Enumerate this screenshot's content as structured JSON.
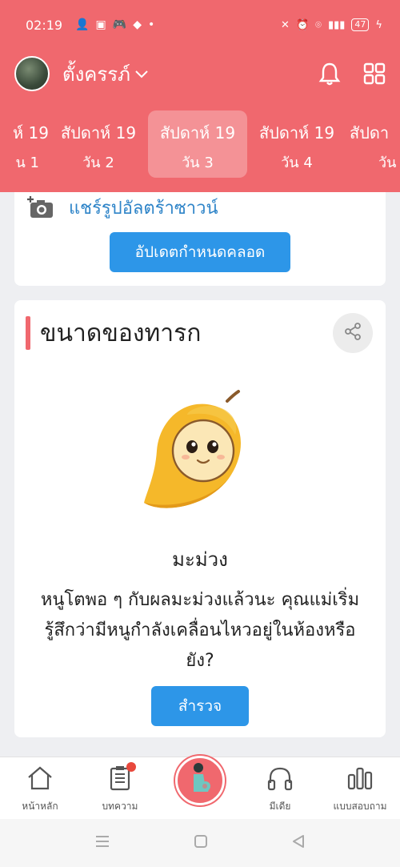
{
  "status_bar": {
    "time": "02:19",
    "battery": "47"
  },
  "header": {
    "username": "ตั้งครรภ์",
    "chevron": "⌄"
  },
  "weeks": [
    {
      "week": "ห์ 19",
      "day": "น 1"
    },
    {
      "week": "สัปดาห์ 19",
      "day": "วัน 2"
    },
    {
      "week": "สัปดาห์ 19",
      "day": "วัน 3",
      "active": true
    },
    {
      "week": "สัปดาห์ 19",
      "day": "วัน 4"
    },
    {
      "week": "สัปดา",
      "day": "วัน"
    }
  ],
  "card_top": {
    "share_photo_label": "แชร์รูปอัลตร้าซาวน์",
    "update_button": "อัปเดตกำหนดคลอด"
  },
  "baby_size": {
    "title": "ขนาดของทารก",
    "fruit_name": "มะม่วง",
    "description": "หนูโตพอ ๆ กับผลมะม่วงแล้วนะ คุณแม่เริ่มรู้สึกว่ามีหนูกำลังเคลื่อนไหวอยู่ในห้องหรือยัง?",
    "survey_button": "สำรวจ"
  },
  "bottom_nav": {
    "home": "หน้าหลัก",
    "articles": "บทความ",
    "media": "มีเดีย",
    "quiz": "แบบสอบถาม"
  },
  "colors": {
    "primary": "#f0686e",
    "button_blue": "#2d96e8",
    "link_blue": "#2e84c8"
  }
}
